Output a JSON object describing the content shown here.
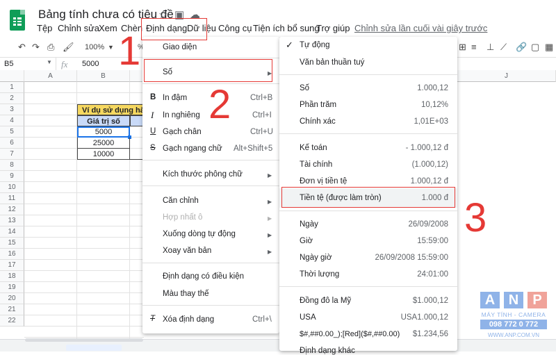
{
  "title_bar": {
    "doc_title": "Bảng tính chưa có tiêu đề"
  },
  "menubar": {
    "items": [
      "Tệp",
      "Chỉnh sửa",
      "Xem",
      "Chèn",
      "Định dạng",
      "Dữ liệu",
      "Công cụ",
      "Tiện ích bổ sung",
      "Trợ giúp"
    ],
    "last_edit": "Chỉnh sửa lần cuối vài giây trước"
  },
  "toolbar": {
    "zoom": "100%",
    "percent": "%"
  },
  "formula_bar": {
    "cell_ref": "B5",
    "fx": "fx",
    "value": "5000"
  },
  "sheet": {
    "columns": [
      "A",
      "B",
      "J"
    ],
    "rows": [
      "1",
      "2",
      "3",
      "4",
      "5",
      "6",
      "7",
      "8",
      "9",
      "10",
      "11",
      "12",
      "13",
      "14",
      "15",
      "16",
      "17",
      "18",
      "19",
      "20",
      "21",
      "22"
    ],
    "header_cell": "Ví dụ sử dụng hàm",
    "sub_header": "Giá trị số",
    "values": [
      "5000",
      "25000",
      "10000"
    ]
  },
  "format_menu": {
    "items": [
      {
        "label": "Giao diện",
        "shortcut": ""
      },
      {
        "label": "Số",
        "shortcut": ""
      },
      {
        "label": "In đậm",
        "shortcut": "Ctrl+B",
        "icon": "B"
      },
      {
        "label": "In nghiêng",
        "shortcut": "Ctrl+I",
        "icon": "I"
      },
      {
        "label": "Gạch chân",
        "shortcut": "Ctrl+U",
        "icon": "U"
      },
      {
        "label": "Gạch ngang chữ",
        "shortcut": "Alt+Shift+5",
        "icon": "S"
      },
      {
        "label": "Kích thước phông chữ",
        "shortcut": ""
      },
      {
        "label": "Căn chỉnh",
        "shortcut": ""
      },
      {
        "label": "Hợp nhất ô",
        "shortcut": ""
      },
      {
        "label": "Xuống dòng tự động",
        "shortcut": ""
      },
      {
        "label": "Xoay văn bản",
        "shortcut": ""
      },
      {
        "label": "Định dạng có điều kiện",
        "shortcut": ""
      },
      {
        "label": "Màu thay thế",
        "shortcut": ""
      },
      {
        "label": "Xóa định dạng",
        "shortcut": "Ctrl+\\"
      }
    ]
  },
  "number_menu": {
    "items": [
      {
        "label": "Tự động",
        "example": ""
      },
      {
        "label": "Văn bản thuần tuý",
        "example": ""
      },
      {
        "label": "Số",
        "example": "1.000,12"
      },
      {
        "label": "Phần trăm",
        "example": "10,12%"
      },
      {
        "label": "Chính xác",
        "example": "1,01E+03"
      },
      {
        "label": "Kế toán",
        "example": "- 1.000,12 đ"
      },
      {
        "label": "Tài chính",
        "example": "(1.000,12)"
      },
      {
        "label": "Đơn vị tiền tệ",
        "example": "1.000,12 đ"
      },
      {
        "label": "Tiền tệ (được làm tròn)",
        "example": "1.000 đ"
      },
      {
        "label": "Ngày",
        "example": "26/09/2008"
      },
      {
        "label": "Giờ",
        "example": "15:59:00"
      },
      {
        "label": "Ngày giờ",
        "example": "26/09/2008 15:59:00"
      },
      {
        "label": "Thời lượng",
        "example": "24:01:00"
      },
      {
        "label": "Đồng đô la Mỹ",
        "example": "$1.000,12"
      },
      {
        "label": "USA",
        "example": "USA1.000,12"
      },
      {
        "label": "$#,##0.00_);[Red]($#,##0.00)",
        "example": "$1.234,56"
      },
      {
        "label": "Định dạng khác",
        "example": ""
      }
    ]
  },
  "annotations": {
    "step1": "1",
    "step2": "2",
    "step3": "3"
  },
  "watermark": {
    "letters": [
      "A",
      "N",
      "P"
    ],
    "line1": "MÁY TÍNH - CAMERA",
    "line2": "098 772 0 772",
    "line3": "WWW.ANP.COM.VN"
  },
  "colors": {
    "accent_red": "#e53935",
    "header_yellow": "#f6d860",
    "header_blue": "#c9daf8",
    "selection_blue": "#1a73e8"
  }
}
